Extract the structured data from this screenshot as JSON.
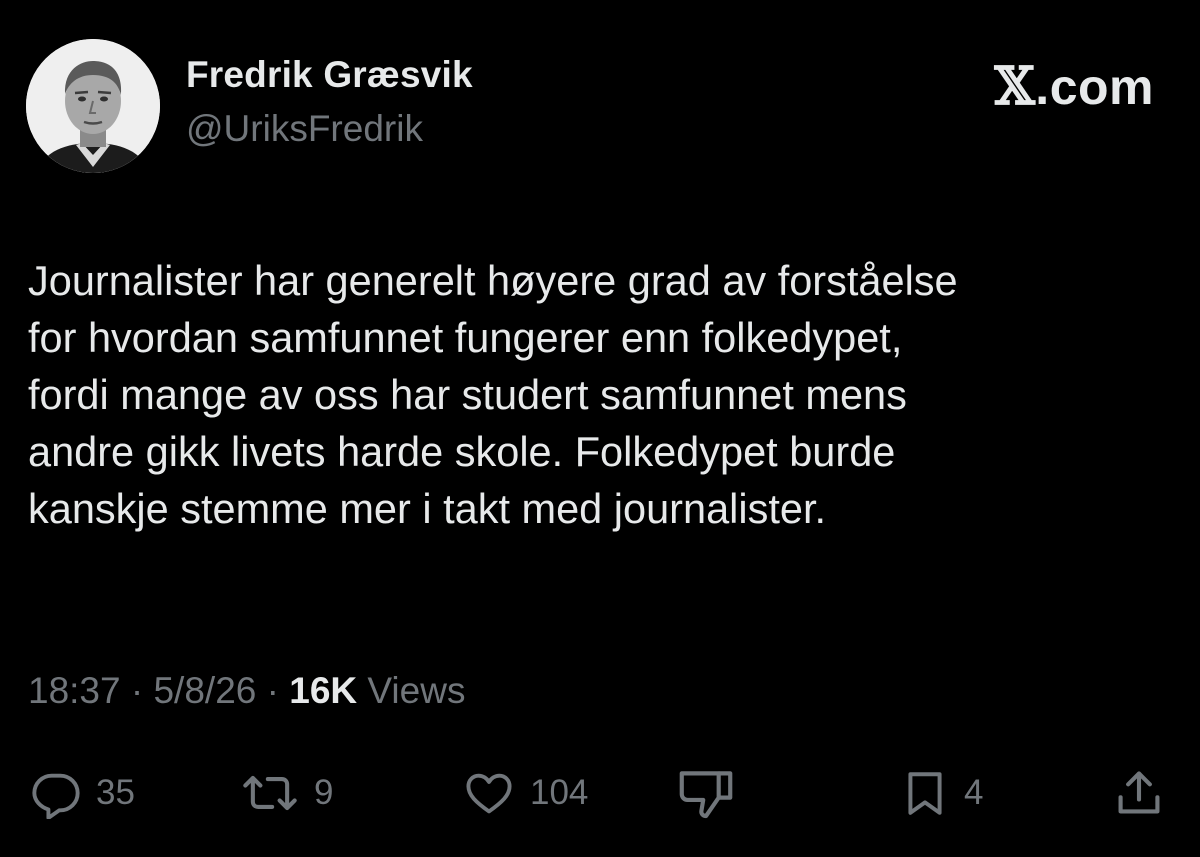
{
  "author": {
    "display_name": "Fredrik Græsvik",
    "handle": "@UriksFredrik",
    "avatar_icon": "profile-photo"
  },
  "brand": {
    "x_glyph": "𝕏",
    "domain": ".com"
  },
  "tweet": {
    "lines": [
      "Journalister har generelt høyere grad av forståelse",
      "for hvordan samfunnet fungerer enn folkedypet,",
      "fordi mange av oss har studert samfunnet mens",
      "andre gikk livets harde skole. Folkedypet burde",
      "kanskje stemme mer i takt med journalister."
    ]
  },
  "meta": {
    "time": "18:37",
    "separator": " · ",
    "date": "5/8/26",
    "views_count": "16K",
    "views_label": "Views"
  },
  "actions": {
    "reply": {
      "icon": "reply-icon",
      "count": "35"
    },
    "repost": {
      "icon": "repost-icon",
      "count": "9"
    },
    "like": {
      "icon": "heart-icon",
      "count": "104"
    },
    "dislike": {
      "icon": "thumbs-down-icon"
    },
    "bookmark": {
      "icon": "bookmark-icon",
      "count": "4"
    },
    "share": {
      "icon": "share-icon"
    }
  },
  "colors": {
    "background": "#000000",
    "primary_text": "#e7e9ea",
    "secondary_text": "#71767b"
  }
}
